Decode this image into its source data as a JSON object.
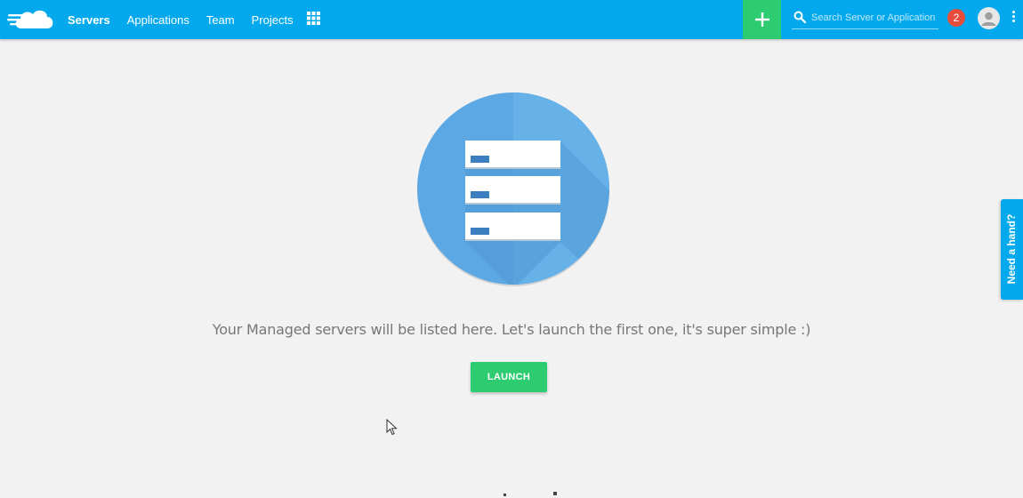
{
  "header": {
    "nav": [
      "Servers",
      "Applications",
      "Team",
      "Projects"
    ],
    "active_nav": "Servers",
    "search_placeholder": "Search Server or Application",
    "notification_count": "2",
    "add_icon": "plus-icon",
    "apps_icon": "grid-icon",
    "menu_icon": "kebab-menu-icon",
    "avatar_icon": "user-avatar-icon",
    "logo_icon": "cloud-logo-icon"
  },
  "main": {
    "illustration_icon": "server-stack-icon",
    "empty_message": "Your Managed servers will be listed here. Let's launch the first one, it's super simple :)",
    "launch_label": "LAUNCH"
  },
  "help_tab": {
    "label": "Need a hand?"
  },
  "colors": {
    "topbar": "#03a9ec",
    "accent_green": "#2ecc71",
    "badge_red": "#e74c3c",
    "illustration_blue": "#5ba8e4",
    "background": "#f2f2f3"
  }
}
